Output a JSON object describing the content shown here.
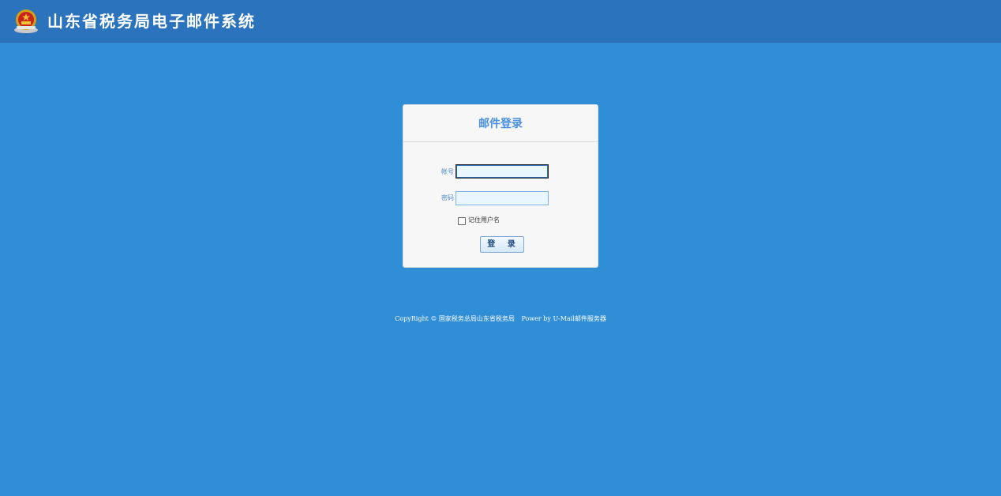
{
  "header": {
    "title": "山东省税务局电子邮件系统",
    "emblem_icon": "national-emblem-icon"
  },
  "login": {
    "title": "邮件登录",
    "account_label": "帐号",
    "account_value": "",
    "password_label": "密码",
    "password_value": "",
    "remember_label": "记住用户名",
    "remember_checked": false,
    "submit_label": "登 录"
  },
  "footer": {
    "copyright": "CopyRight © 国家税务总局山东省税务局",
    "powered_by": "Power by U-Mail邮件服务器"
  },
  "colors": {
    "background": "#308ed6",
    "header": "#2b74bd",
    "title_accent": "#4a90e0"
  }
}
